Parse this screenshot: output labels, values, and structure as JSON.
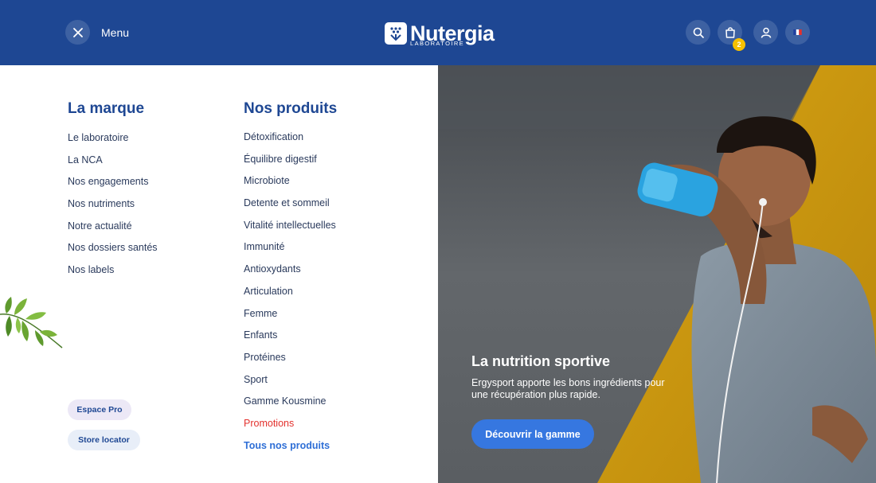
{
  "header": {
    "menu_label": "Menu",
    "logo_word": "Nutergia",
    "logo_sub": "LABORATOIRE",
    "cart_count": "2",
    "icons": [
      "close-icon",
      "search-icon",
      "shopping-bag-icon",
      "user-icon",
      "french-flag-icon"
    ]
  },
  "brand": {
    "title": "La marque",
    "items": [
      "Le laboratoire",
      "La NCA",
      "Nos engagements",
      "Nos nutriments",
      "Notre actualité",
      "Nos dossiers santés",
      "Nos labels"
    ]
  },
  "products": {
    "title": "Nos produits",
    "items": [
      "Détoxification",
      "Équilibre digestif",
      "Microbiote",
      "Detente et sommeil",
      "Vitalité intellectuelles",
      "Immunité",
      "Antioxydants",
      "Articulation",
      "Femme",
      "Enfants",
      "Protéines",
      "Sport",
      "Gamme Kousmine"
    ],
    "promo": "Promotions",
    "all": "Tous nos produits"
  },
  "pills": {
    "pro": "Espace Pro",
    "store": "Store locator"
  },
  "hero": {
    "title": "La nutrition sportive",
    "desc": "Ergysport apporte les bons ingrédients pour une récupération plus rapide.",
    "cta": "Découvrir la gamme"
  },
  "colors": {
    "header_bg": "#1e4793",
    "title": "#1e4793",
    "promo": "#e3312d",
    "link": "#2f6fd6",
    "cta": "#3677e0",
    "badge": "#f7c100"
  }
}
